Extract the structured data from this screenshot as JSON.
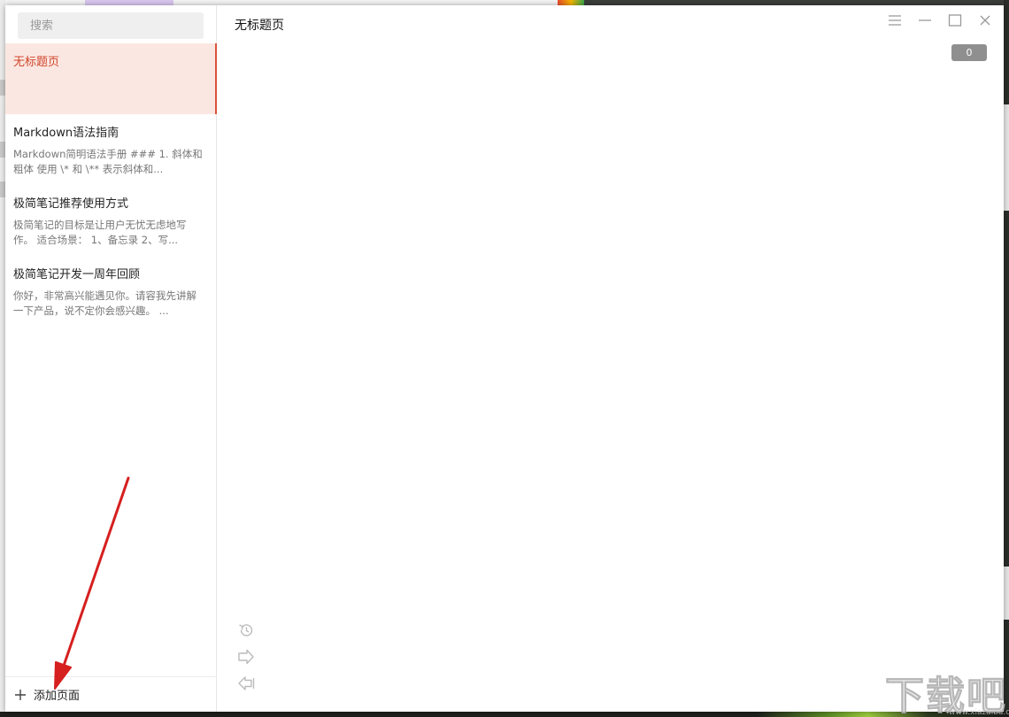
{
  "sidebar": {
    "search_placeholder": "搜索",
    "notes": [
      {
        "title": "无标题页",
        "preview": "",
        "active": true
      },
      {
        "title": "Markdown语法指南",
        "preview": "Markdown简明语法手册  ### 1. 斜体和粗体  使用 \\* 和 \\** 表示斜体和...",
        "active": false
      },
      {
        "title": "极简笔记推荐使用方式",
        "preview": "极简笔记的目标是让用户无忧无虑地写作。 适合场景： 1、备忘录 2、写...",
        "active": false
      },
      {
        "title": "极简笔记开发一周年回顾",
        "preview": "你好，非常高兴能遇见你。请容我先讲解一下产品，说不定你会感兴趣。 ...",
        "active": false
      }
    ],
    "add_page_label": "添加页面"
  },
  "editor": {
    "title": "无标题页",
    "word_count": "0"
  },
  "icons": {
    "menu": "hamburger-menu-icon",
    "minimize": "minimize-icon",
    "maximize": "maximize-icon",
    "close": "close-icon",
    "history": "history-icon",
    "share": "share-icon",
    "collapse": "collapse-left-icon",
    "add": "plus-icon"
  },
  "colors": {
    "accent": "#d9533c",
    "active_bg": "#fbe7e1",
    "badge_bg": "#8f8f8f",
    "annotation_arrow": "#d61f1f"
  },
  "watermark": {
    "text": "下载吧",
    "url": "www.xiazaiba.com"
  }
}
